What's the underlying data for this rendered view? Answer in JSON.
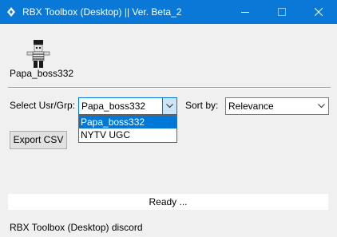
{
  "window": {
    "title": "RBX Toolbox (Desktop) || Ver. Beta_2",
    "icon": "rbx-toolbox-icon",
    "controls": {
      "minimize": "minimize-icon",
      "maximize": "maximize-icon",
      "close": "close-icon"
    },
    "accent_color": "#0a78d7"
  },
  "profile": {
    "username": "Papa_boss332",
    "avatar_icon": "roblox-avatar"
  },
  "filters": {
    "select_label": "Select Usr/Grp:",
    "selected_user": "Papa_boss332",
    "user_options": [
      "Papa_boss332",
      "NYTV UGC"
    ],
    "highlighted_option": "Papa_boss332",
    "sort_label": "Sort by:",
    "sort_value": "Relevance"
  },
  "actions": {
    "export_label": "Export CSV"
  },
  "status": {
    "text": "Ready ..."
  },
  "footer": {
    "discord_link": "RBX Toolbox (Desktop) discord"
  }
}
